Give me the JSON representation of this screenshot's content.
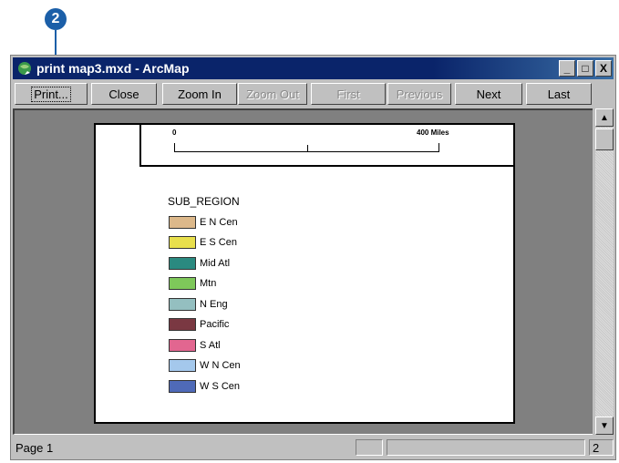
{
  "callout": {
    "number": "2"
  },
  "window": {
    "title": "print map3.mxd - ArcMap",
    "controls": {
      "minimize": "_",
      "maximize": "□",
      "close": "X"
    }
  },
  "toolbar": {
    "print_label": "Print...",
    "close_label": "Close",
    "zoom_in_label": "Zoom In",
    "zoom_out_label": "Zoom Out",
    "first_label": "First",
    "previous_label": "Previous",
    "next_label": "Next",
    "last_label": "Last"
  },
  "map_page": {
    "scale_bar": {
      "start": "0",
      "end": "400 Miles"
    },
    "legend": {
      "title": "SUB_REGION",
      "items": [
        {
          "label": "E N Cen",
          "color": "#dcb88a"
        },
        {
          "label": "E S Cen",
          "color": "#e8df4c"
        },
        {
          "label": "Mid Atl",
          "color": "#2a8a80"
        },
        {
          "label": "Mtn",
          "color": "#7ec85a"
        },
        {
          "label": "N Eng",
          "color": "#94bfc0"
        },
        {
          "label": "Pacific",
          "color": "#7a3842"
        },
        {
          "label": "S Atl",
          "color": "#e26690"
        },
        {
          "label": "W N Cen",
          "color": "#a4c8ec"
        },
        {
          "label": "W S Cen",
          "color": "#4f6ab8"
        }
      ]
    }
  },
  "statusbar": {
    "page": "Page 1",
    "page_count": "2"
  }
}
